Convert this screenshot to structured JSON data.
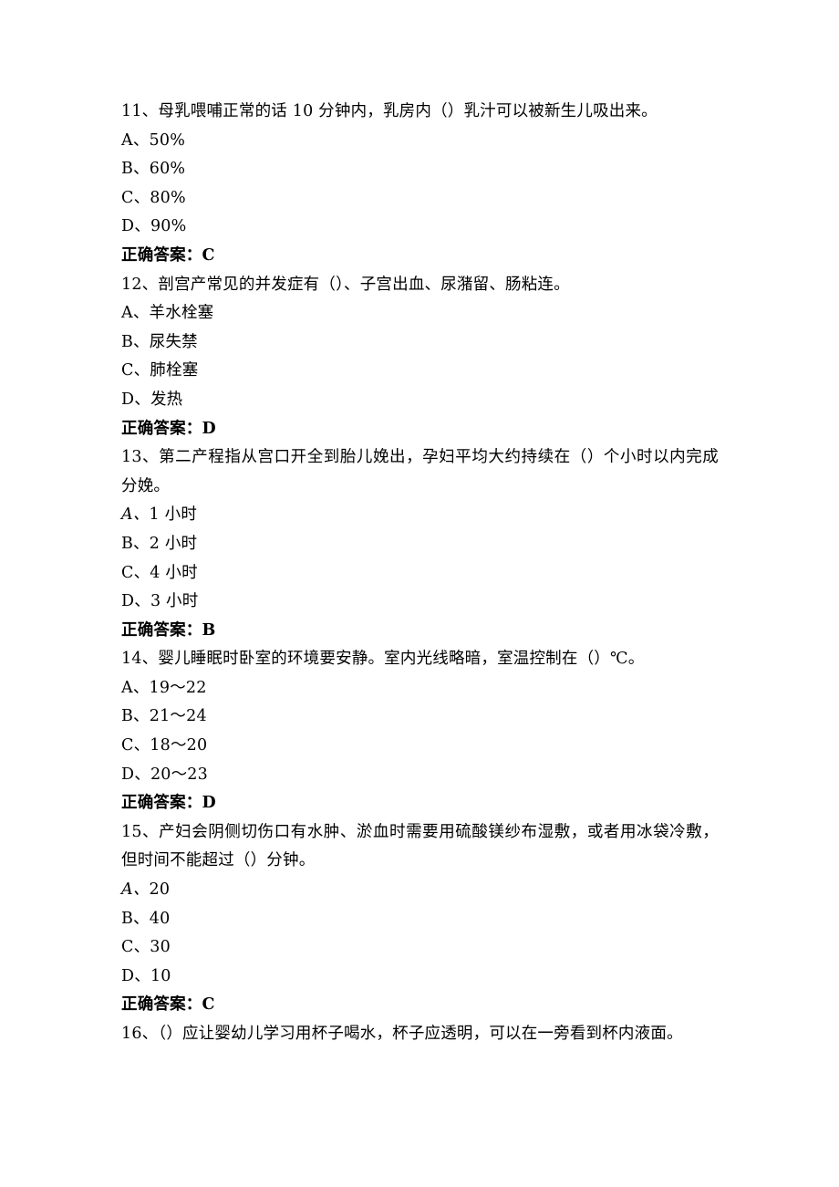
{
  "document": {
    "answer_label": "正确答案：",
    "questions": [
      {
        "number": "11、",
        "stem": "母乳喂哺正常的话 10 分钟内，乳房内（）乳汁可以被新生儿吸出来。",
        "options": [
          {
            "label": "A、",
            "italic_label": false,
            "text": "50%"
          },
          {
            "label": "B、",
            "italic_label": false,
            "text": "60%"
          },
          {
            "label": "C、",
            "italic_label": false,
            "text": "80%"
          },
          {
            "label": "D、",
            "italic_label": false,
            "text": "90%"
          }
        ],
        "answer": "C"
      },
      {
        "number": "12、",
        "stem": "剖宫产常见的并发症有（）、子宫出血、尿潴留、肠粘连。",
        "options": [
          {
            "label": "A、",
            "italic_label": false,
            "text": "羊水栓塞"
          },
          {
            "label": "B、",
            "italic_label": false,
            "text": "尿失禁"
          },
          {
            "label": "C、",
            "italic_label": false,
            "text": "肺栓塞"
          },
          {
            "label": "D、",
            "italic_label": false,
            "text": "发热"
          }
        ],
        "answer": "D"
      },
      {
        "number": "13、",
        "stem": "第二产程指从宫口开全到胎儿娩出，孕妇平均大约持续在（）个小时以内完成分娩。",
        "options": [
          {
            "label": "A、",
            "italic_label": true,
            "text": "1 小时"
          },
          {
            "label": "B、",
            "italic_label": false,
            "text": "2 小时"
          },
          {
            "label": "C、",
            "italic_label": false,
            "text": "4 小时"
          },
          {
            "label": "D、",
            "italic_label": false,
            "text": "3 小时"
          }
        ],
        "answer": "B"
      },
      {
        "number": "14、",
        "stem": "婴儿睡眠时卧室的环境要安静。室内光线略暗，室温控制在（）℃。",
        "options": [
          {
            "label": "A、",
            "italic_label": false,
            "text": "19～22"
          },
          {
            "label": "B、",
            "italic_label": false,
            "text": "21～24"
          },
          {
            "label": "C、",
            "italic_label": false,
            "text": "18～20"
          },
          {
            "label": "D、",
            "italic_label": false,
            "text": "20～23"
          }
        ],
        "answer": "D"
      },
      {
        "number": "15、",
        "stem": "产妇会阴侧切伤口有水肿、淤血时需要用硫酸镁纱布湿敷，或者用冰袋冷敷，但时间不能超过（）分钟。",
        "options": [
          {
            "label": "A、",
            "italic_label": true,
            "text": "20"
          },
          {
            "label": "B、",
            "italic_label": false,
            "text": "40"
          },
          {
            "label": "C、",
            "italic_label": false,
            "text": "30"
          },
          {
            "label": "D、",
            "italic_label": false,
            "text": "10"
          }
        ],
        "answer": "C"
      },
      {
        "number": "16、",
        "stem": "（）应让婴幼儿学习用杯子喝水，杯子应透明，可以在一旁看到杯内液面。",
        "options": [],
        "answer": null
      }
    ]
  }
}
